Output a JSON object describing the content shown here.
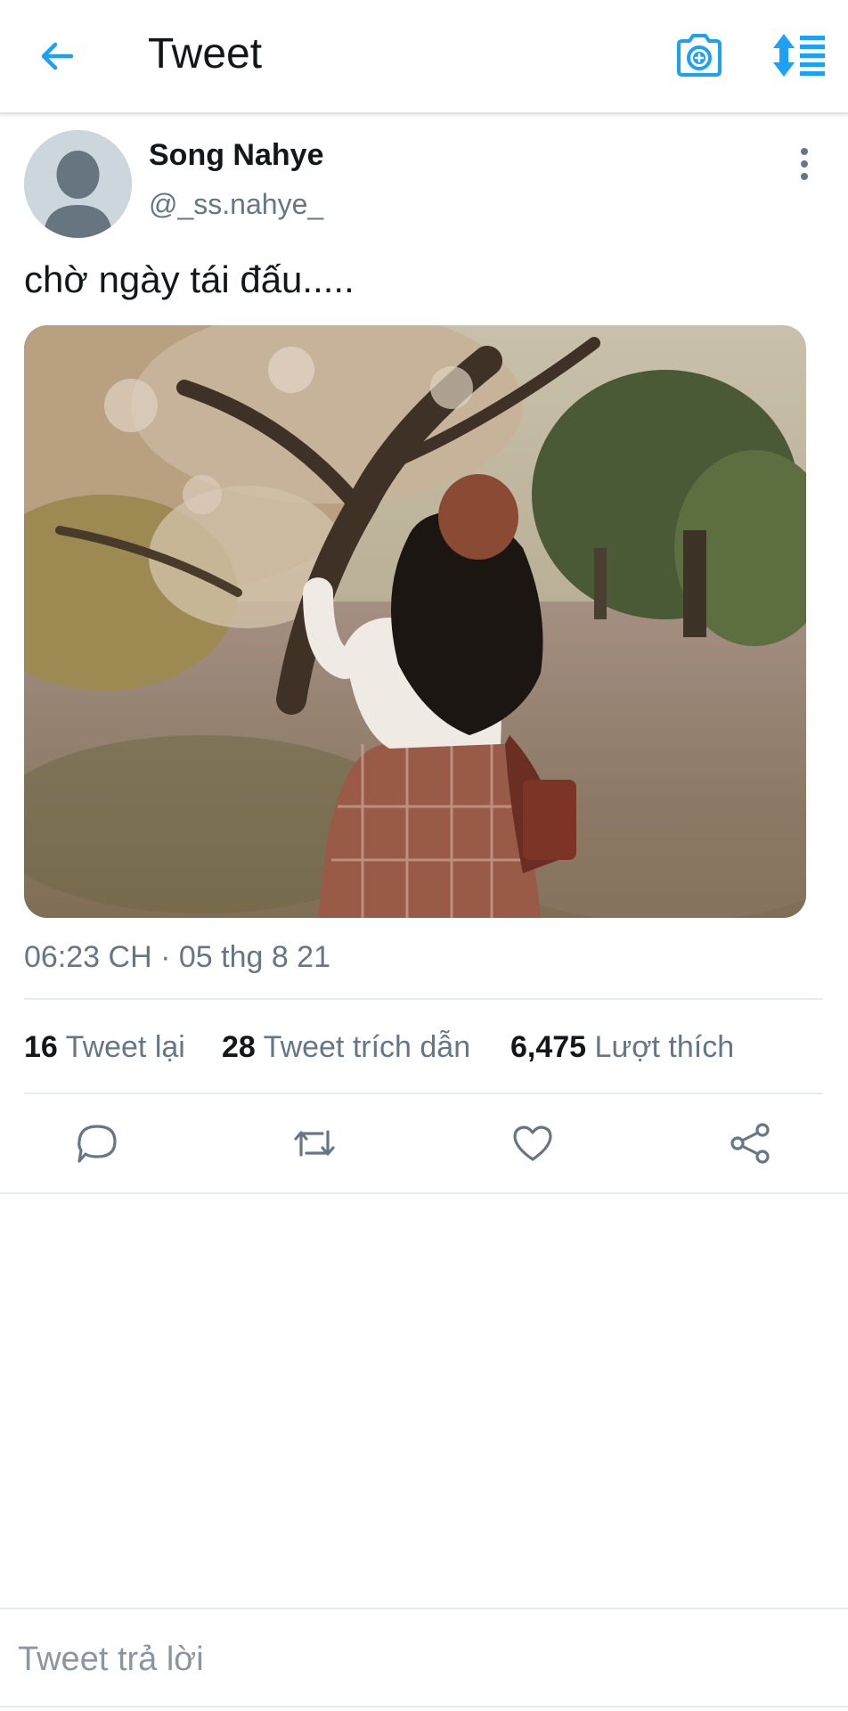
{
  "header": {
    "title": "Tweet",
    "back_icon": "arrow-left-icon",
    "camera_icon": "camera-plus-icon",
    "sort_icon": "sort-list-icon",
    "accent_color": "#1da1f2"
  },
  "tweet": {
    "author_name": "Song Nahye",
    "author_handle": "@_ss.nahye_",
    "text": "chờ ngày tái đấu.....",
    "timestamp": "06:23 CH · 05 thg 8 21",
    "stats": {
      "retweets_count": "16",
      "retweets_label": "Tweet lại",
      "quotes_count": "28",
      "quotes_label": "Tweet trích dẫn",
      "likes_count": "6,475",
      "likes_label": "Lượt thích"
    },
    "actions": [
      "reply-icon",
      "retweet-icon",
      "like-icon",
      "share-icon"
    ]
  },
  "reply": {
    "placeholder": "Tweet trả lời",
    "value": ""
  }
}
